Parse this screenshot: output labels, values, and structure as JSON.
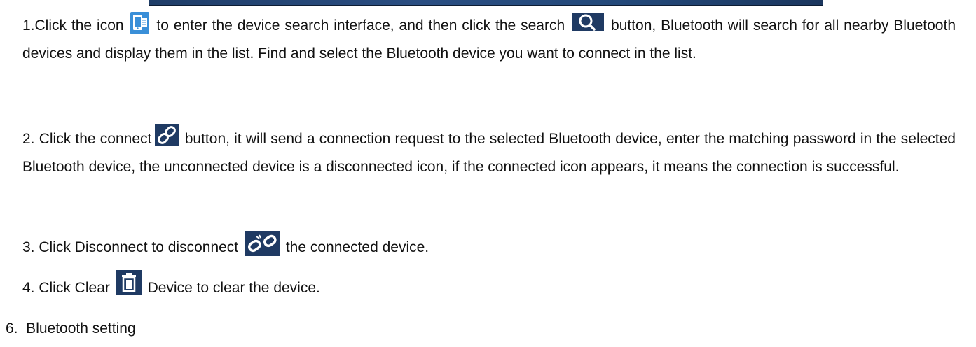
{
  "step1": {
    "part_a": "1.Click the icon",
    "part_b": "to enter the device search interface, and then click the search",
    "part_c": "button, Bluetooth will search for all nearby Bluetooth devices and display them in the list. Find and select the Bluetooth device you want to connect in the list."
  },
  "step2": {
    "part_a": "2. Click the connect",
    "part_b": "button, it will send a connection request to the selected Bluetooth device, enter the matching password in the selected Bluetooth device, the unconnected device is a disconnected icon, if the connected icon appears, it means the connection is successful."
  },
  "step3": {
    "part_a": "3. Click Disconnect to disconnect",
    "part_b": "the connected device."
  },
  "step4": {
    "part_a": "4. Click Clear",
    "part_b": "Device to clear the device."
  },
  "section_heading": "6.  Bluetooth setting",
  "icons": {
    "device": "device-icon",
    "search": "search-icon",
    "connect": "connect-link-icon",
    "disconnect": "disconnect-link-icon",
    "clear": "trash-icon"
  },
  "colors": {
    "icon_bg": "#1f3a63",
    "device_icon_bg": "#3a8fd8"
  }
}
